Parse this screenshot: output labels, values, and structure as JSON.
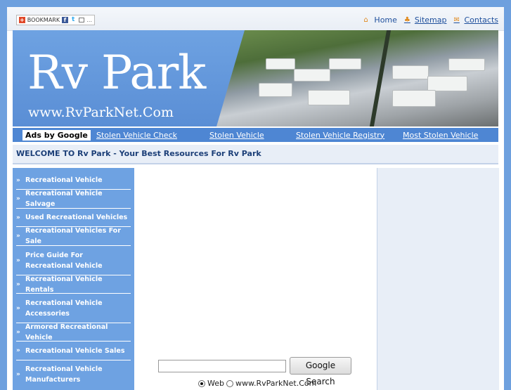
{
  "bookmark": {
    "label": "BOOKMARK",
    "more": "..."
  },
  "toplinks": {
    "home": "Home",
    "sitemap": "Sitemap",
    "contacts": "Contacts"
  },
  "header": {
    "title": "Rv Park",
    "url": "www.RvParkNet.Com"
  },
  "nav": {
    "ads_label": "Ads by Google",
    "links": [
      "Stolen Vehicle Check",
      "Stolen Vehicle",
      "Stolen Vehicle Registry",
      "Most Stolen Vehicle"
    ]
  },
  "welcome": "WELCOME TO Rv Park - Your Best Resources For Rv Park",
  "sidebar": {
    "items": [
      "Recreational Vehicle",
      "Recreational Vehicle Salvage",
      "Used Recreational Vehicles",
      "Recreational Vehicles For Sale",
      "Price Guide For Recreational Vehicle",
      "Recreational Vehicle Rentals",
      "Recreational Vehicle Accessories",
      "Armored Recreational Vehicle",
      "Recreational Vehicle Sales",
      "Recreational Vehicle Manufacturers"
    ]
  },
  "search": {
    "button_label": "Google Search",
    "input_value": "",
    "options": [
      "Web",
      "www.RvParkNet.Com"
    ],
    "selected": "Web"
  },
  "colors": {
    "frame": "#6ea0de",
    "nav": "#4e86d3",
    "sidebar": "#6ea2e2",
    "link": "#1e4f9c"
  }
}
